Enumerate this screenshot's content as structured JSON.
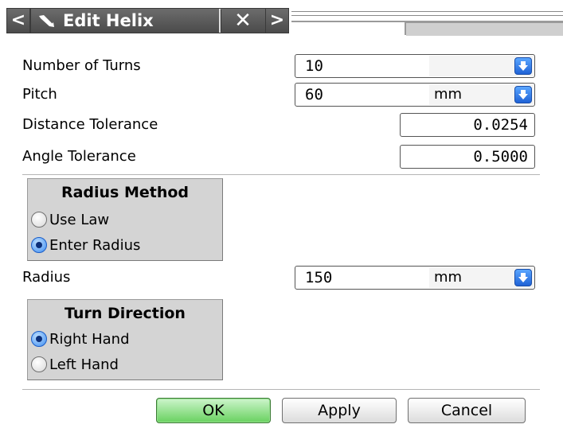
{
  "window": {
    "title": "Edit Helix",
    "prev_icon": "chevron-left-icon",
    "next_icon": "chevron-right-icon",
    "pin_icon": "pin-icon",
    "close_icon": "close-icon",
    "prev_glyph": "<",
    "next_glyph": ">",
    "close_glyph": "✕"
  },
  "fields": {
    "number_of_turns": {
      "label": "Number of Turns",
      "value": "10"
    },
    "pitch": {
      "label": "Pitch",
      "value": "60",
      "unit": "mm"
    },
    "distance_tolerance": {
      "label": "Distance Tolerance",
      "value": "0.0254"
    },
    "angle_tolerance": {
      "label": "Angle Tolerance",
      "value": "0.5000"
    },
    "radius": {
      "label": "Radius",
      "value": "150",
      "unit": "mm"
    }
  },
  "radius_method": {
    "title": "Radius Method",
    "options": [
      {
        "label": "Use Law",
        "selected": false
      },
      {
        "label": "Enter Radius",
        "selected": true
      }
    ]
  },
  "turn_direction": {
    "title": "Turn Direction",
    "options": [
      {
        "label": "Right Hand",
        "selected": true
      },
      {
        "label": "Left Hand",
        "selected": false
      }
    ]
  },
  "buttons": {
    "ok": "OK",
    "apply": "Apply",
    "cancel": "Cancel"
  },
  "colors": {
    "ok_button": "#68d15f",
    "dropdown_button": "#1f62d6",
    "radio_selected": "#3d8cf0",
    "title_tab": "#4b4b4b"
  }
}
